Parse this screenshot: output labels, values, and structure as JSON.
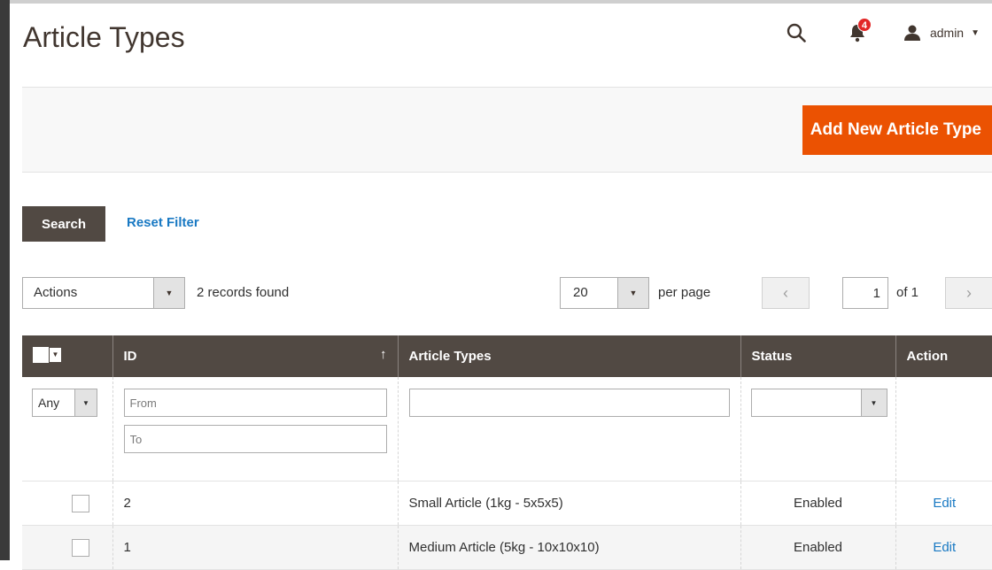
{
  "header": {
    "title": "Article Types",
    "notifications_count": "4",
    "user_name": "admin",
    "icons": [
      "search-icon",
      "bell-icon",
      "user-icon",
      "caret-down-icon"
    ]
  },
  "action_bar": {
    "add_button": "Add New Article Type"
  },
  "filters_bar": {
    "search_button": "Search",
    "reset_link": "Reset Filter"
  },
  "toolbar": {
    "actions_select": "Actions",
    "records_found": "2 records found",
    "per_page_value": "20",
    "per_page_label": "per page",
    "current_page": "1",
    "of_pages": "of 1",
    "prev_icon": "chevron-left-icon",
    "next_icon": "chevron-right-icon"
  },
  "grid": {
    "columns": [
      "ID",
      "Article Types",
      "Status",
      "Action"
    ],
    "filters": {
      "mass_select": "Any",
      "id_from_placeholder": "From",
      "id_to_placeholder": "To",
      "article_type_value": "",
      "status_value": ""
    },
    "rows": [
      {
        "id": "2",
        "article_type": "Small Article (1kg - 5x5x5)",
        "status": "Enabled",
        "action": "Edit"
      },
      {
        "id": "1",
        "article_type": "Medium Article (5kg - 10x10x10)",
        "status": "Enabled",
        "action": "Edit"
      }
    ]
  },
  "colors": {
    "accent_orange": "#eb5202",
    "header_dark": "#514943",
    "link_blue": "#1979c3",
    "badge_red": "#e22626"
  }
}
